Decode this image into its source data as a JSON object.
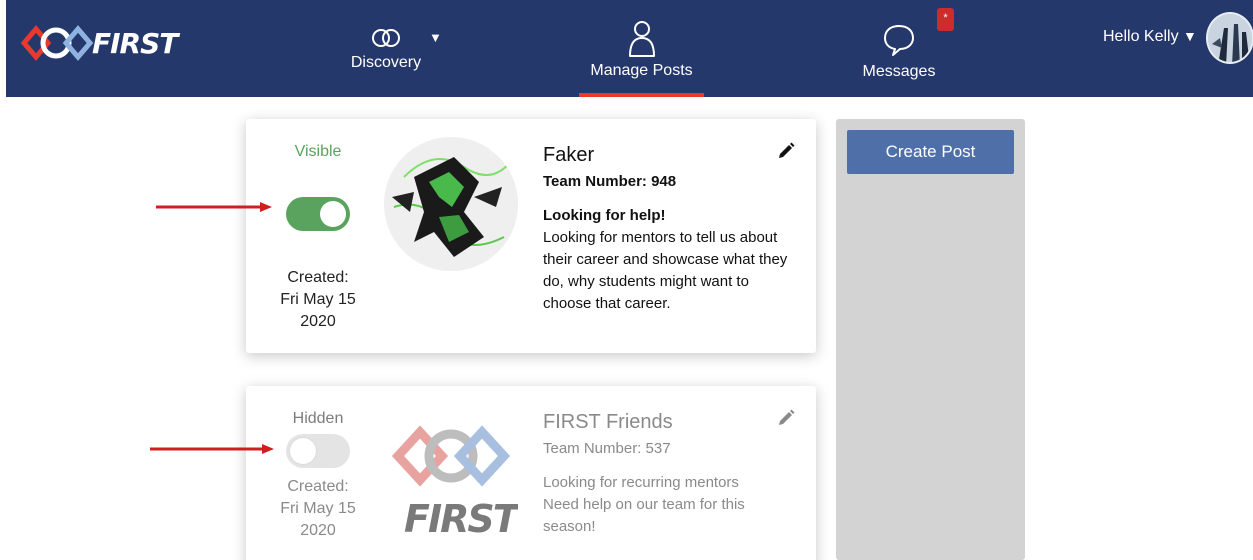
{
  "nav": {
    "logo_text": "FIRST",
    "discovery_label": "Discovery",
    "manage_posts_label": "Manage Posts",
    "messages_label": "Messages",
    "messages_badge": "*",
    "user_greeting": "Hello Kelly",
    "caret": "▼"
  },
  "sidebar": {
    "create_post_label": "Create Post"
  },
  "posts": [
    {
      "status": "Visible",
      "visible": true,
      "created_label": "Created:",
      "created_date": "Fri May 15",
      "created_year": "2020",
      "name": "Faker",
      "team": "Team Number: 948",
      "heading": "Looking for help!",
      "text": "Looking for mentors to tell us about their career and showcase what they do, why students might want to choose that career."
    },
    {
      "status": "Hidden",
      "visible": false,
      "created_label": "Created:",
      "created_date": "Fri May 15",
      "created_year": "2020",
      "name": "FIRST Friends",
      "team": "Team Number: 537",
      "heading": "Looking for recurring mentors",
      "text": "Need help on our team for this season!",
      "logo_text": "FIRST"
    }
  ],
  "colors": {
    "nav_bg": "#25386c",
    "active_underline": "#e8392f",
    "visible_green": "#5aa35f",
    "create_button": "#4f6fa8",
    "annotation_arrow": "#cc1f1f"
  }
}
